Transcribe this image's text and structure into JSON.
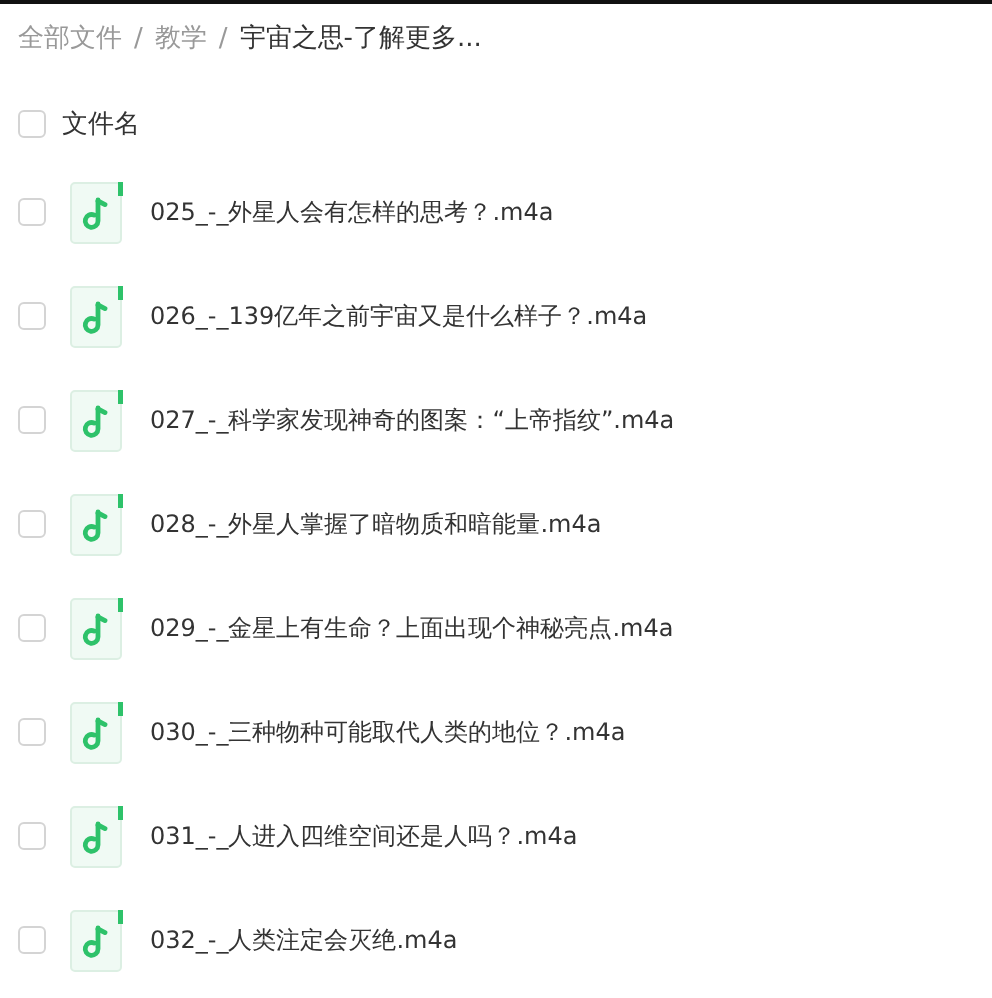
{
  "breadcrumb": [
    {
      "kind": "link",
      "label": "全部文件",
      "current": false
    },
    {
      "kind": "separator",
      "label": "/"
    },
    {
      "kind": "link",
      "label": "教学",
      "current": false
    },
    {
      "kind": "separator",
      "label": "/"
    },
    {
      "kind": "link",
      "label": "宇宙之思-了解更多...",
      "current": true
    }
  ],
  "header": {
    "checked": false,
    "label": "文件名"
  },
  "files": [
    {
      "name": "025_-_外星人会有怎样的思考？.m4a",
      "checked": false
    },
    {
      "name": "026_-_139亿年之前宇宙又是什么样子？.m4a",
      "checked": false
    },
    {
      "name": "027_-_科学家发现神奇的图案：“上帝指纹”.m4a",
      "checked": false
    },
    {
      "name": "028_-_外星人掌握了暗物质和暗能量.m4a",
      "checked": false
    },
    {
      "name": "029_-_金星上有生命？上面出现个神秘亮点.m4a",
      "checked": false
    },
    {
      "name": "030_-_三种物种可能取代人类的地位？.m4a",
      "checked": false
    },
    {
      "name": "031_-_人进入四维空间还是人吗？.m4a",
      "checked": false
    },
    {
      "name": "032_-_人类注定会灭绝.m4a",
      "checked": false
    }
  ]
}
